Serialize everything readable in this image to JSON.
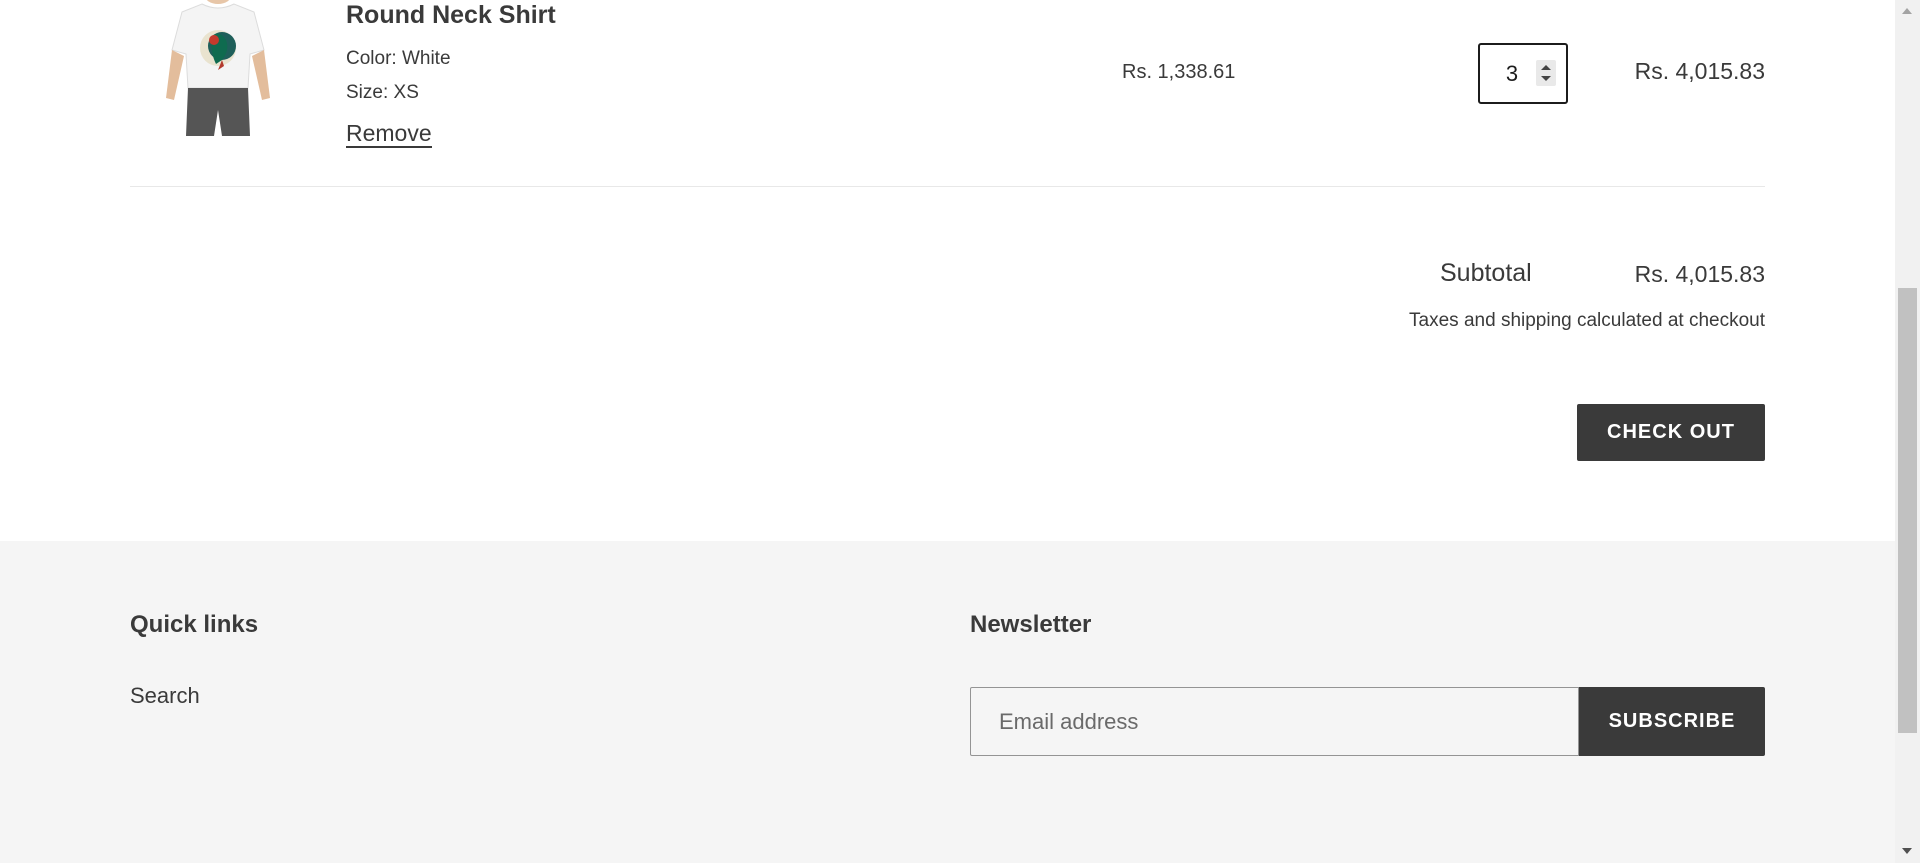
{
  "cart": {
    "item": {
      "title": "Round Neck Shirt",
      "color": "Color: White",
      "size": "Size: XS",
      "remove_label": "Remove",
      "unit_price": "Rs. 1,338.61",
      "quantity": "3",
      "line_total": "Rs. 4,015.83"
    },
    "subtotal_label": "Subtotal",
    "subtotal_value": "Rs. 4,015.83",
    "shipping_note": "Taxes and shipping calculated at checkout",
    "checkout_label": "CHECK OUT"
  },
  "footer": {
    "quick_links_heading": "Quick links",
    "quick_links": [
      "Search"
    ],
    "newsletter_heading": "Newsletter",
    "email_placeholder": "Email address",
    "subscribe_label": "SUBSCRIBE"
  },
  "colors": {
    "text": "#3a3a3a",
    "button_bg": "#3a3a3a",
    "footer_bg": "#f5f5f5"
  }
}
